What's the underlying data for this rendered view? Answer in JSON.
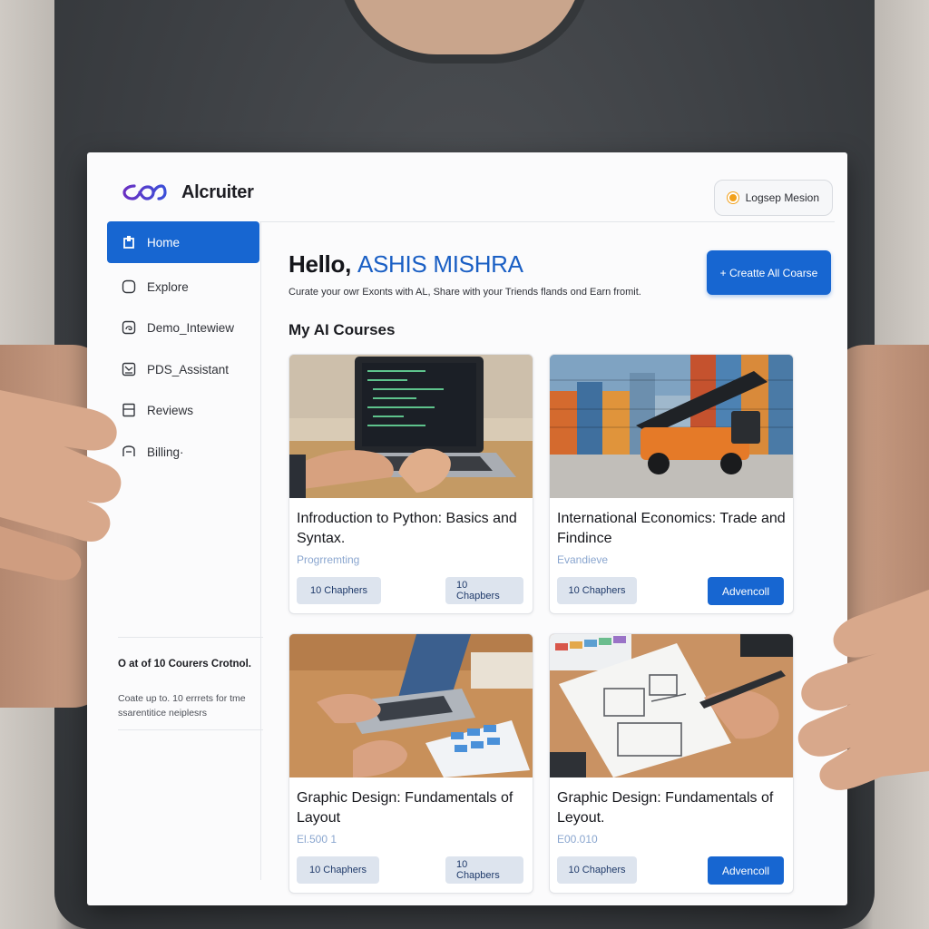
{
  "app": {
    "name": "Alcruiter"
  },
  "header": {
    "session_label": "Logsep Mesion"
  },
  "sidebar": {
    "items": [
      {
        "label": "Home",
        "icon": "home-icon",
        "active": true
      },
      {
        "label": "Explore",
        "icon": "compass-icon",
        "active": false
      },
      {
        "label": "Demo_Intewiew",
        "icon": "interview-icon",
        "active": false
      },
      {
        "label": "PDS_Assistant",
        "icon": "assistant-icon",
        "active": false
      },
      {
        "label": "Reviews",
        "icon": "reviews-icon",
        "active": false
      },
      {
        "label": "Billing·",
        "icon": "billing-icon",
        "active": false
      }
    ],
    "note": {
      "title": "O at of 10 Courers Crotnol.",
      "body": "Coate up to. 10 errrets for tme ssarentitice neiplesrs"
    }
  },
  "main": {
    "greeting": "Hello,",
    "user_name": "ASHIS MISHRA",
    "subtitle": "Curate your owr Exonts with AL, Share with your Triends flands ond Earn fromit.",
    "create_button": "+ Creatte All Coarse",
    "section_title": "My AI Courses",
    "courses": [
      {
        "title": "Infroduction to Python: Basics and Syntax.",
        "category": "Progrremting",
        "pill_left": "10 Chaphers",
        "pill_right": "10 Chapbers",
        "image": "laptop-coding-photo"
      },
      {
        "title": "International Economics: Trade and Findince",
        "category": "Evandieve",
        "pill_left": "10 Chaphers",
        "button": "Advencoll",
        "image": "shipping-containers-photo"
      },
      {
        "title": "Graphic Design: Fundamentals of Layout",
        "category": "El.500 1",
        "pill_left": "10 Chaphers",
        "pill_right": "10 Chapbers",
        "image": "design-laptop-photo"
      },
      {
        "title": "Graphic Design: Fundamentals of Leyout.",
        "category": "E00.010",
        "pill_left": "10 Chaphers",
        "button": "Advencoll",
        "image": "wireframe-sketch-photo"
      }
    ]
  },
  "colors": {
    "accent": "#1766d1",
    "brand_logo": "#5a2fc2",
    "category_text": "#8aa6cf",
    "pill_bg": "#dde4ee"
  }
}
